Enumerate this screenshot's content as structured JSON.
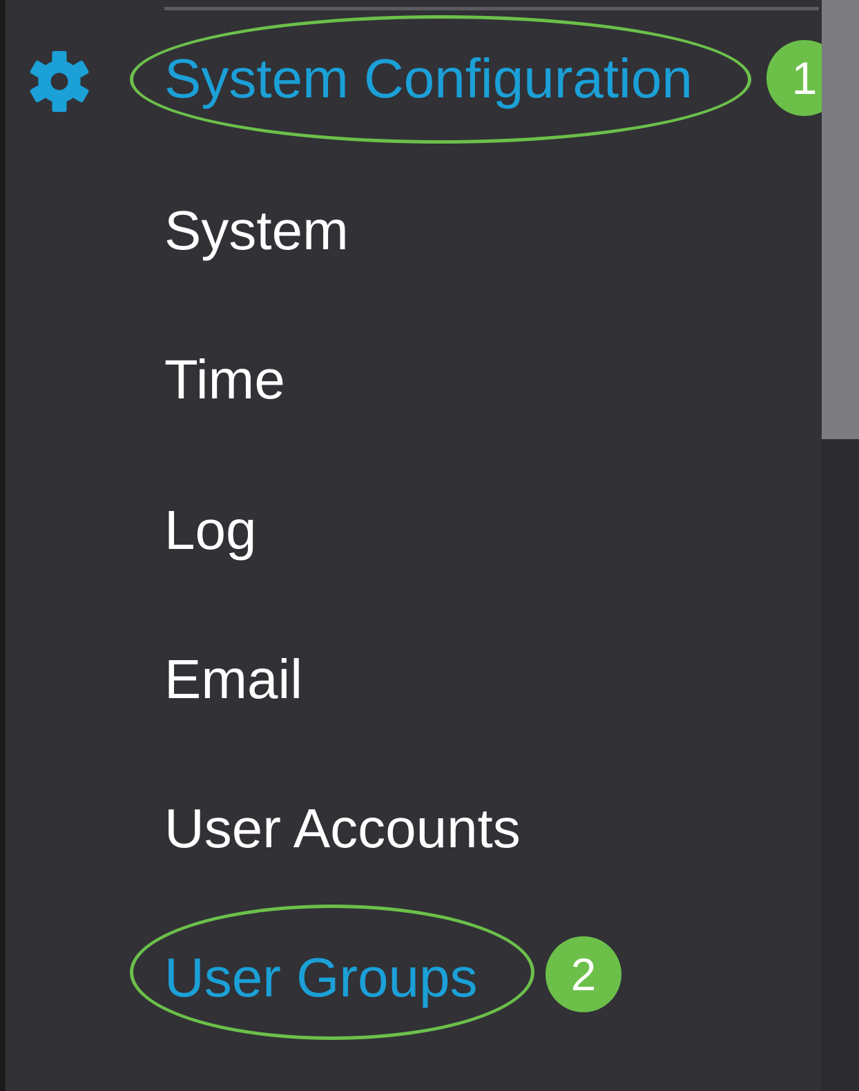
{
  "sidebar": {
    "section": {
      "icon": "gear-icon",
      "label": "System Configuration"
    },
    "items": [
      {
        "label": "System"
      },
      {
        "label": "Time"
      },
      {
        "label": "Log"
      },
      {
        "label": "Email"
      },
      {
        "label": "User Accounts"
      },
      {
        "label": "User Groups"
      }
    ]
  },
  "annotations": {
    "step1": "1",
    "step2": "2"
  },
  "colors": {
    "panel_background": "#313136",
    "active_text": "#1ba0d7",
    "default_text": "#ffffff",
    "highlight": "#6cc04a",
    "scrollbar_thumb": "#7d7d80"
  }
}
